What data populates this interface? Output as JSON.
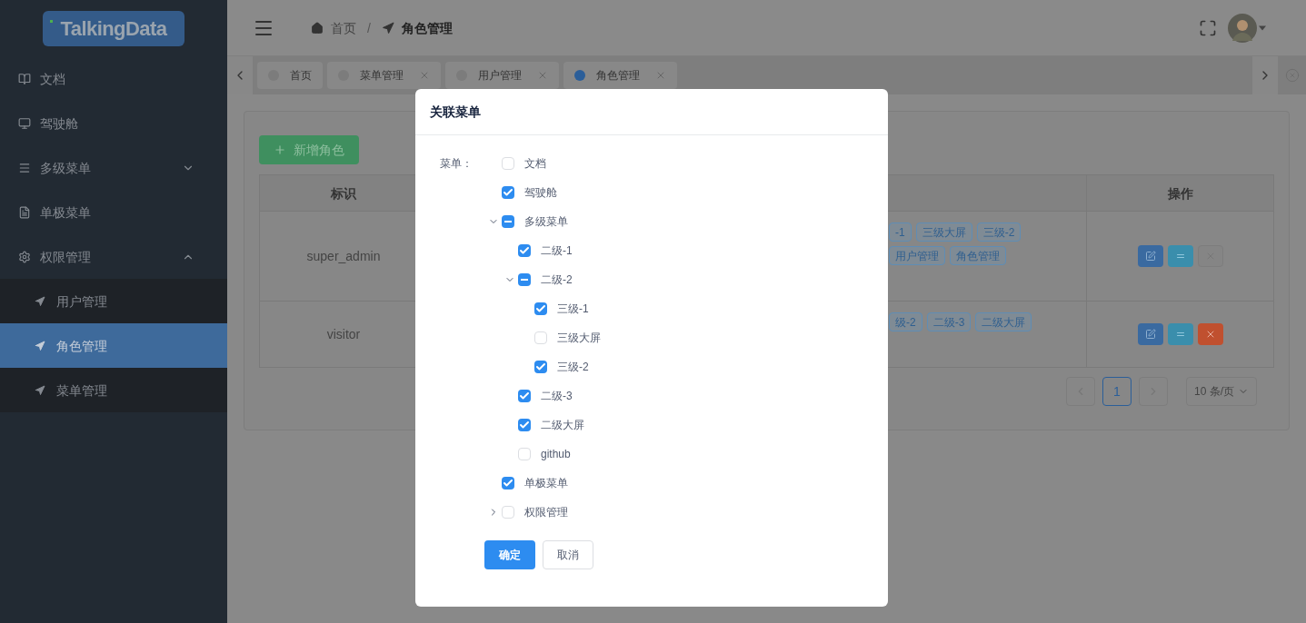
{
  "logo": {
    "text": "TalkingData"
  },
  "sidebar": {
    "items": [
      {
        "label": "文档",
        "kind": "book",
        "selected": false
      },
      {
        "label": "驾驶舱",
        "kind": "monitor",
        "selected": false
      },
      {
        "label": "多级菜单",
        "kind": "list",
        "selected": false,
        "expanded": false
      },
      {
        "label": "单极菜单",
        "kind": "file",
        "selected": false
      },
      {
        "label": "权限管理",
        "kind": "gear",
        "selected": false,
        "expanded": true,
        "children": [
          {
            "label": "用户管理",
            "selected": false
          },
          {
            "label": "角色管理",
            "selected": true
          },
          {
            "label": "菜单管理",
            "selected": false
          }
        ]
      }
    ]
  },
  "breadcrumb": {
    "separator": "/",
    "items": [
      {
        "label": "首页",
        "kind": "home"
      },
      {
        "label": "角色管理",
        "kind": "nav"
      }
    ]
  },
  "tabs": [
    {
      "label": "首页",
      "selected": false,
      "closable": false
    },
    {
      "label": "菜单管理",
      "selected": false,
      "closable": true
    },
    {
      "label": "用户管理",
      "selected": false,
      "closable": true
    },
    {
      "label": "角色管理",
      "selected": true,
      "closable": true
    }
  ],
  "add_button": {
    "label": "新增角色"
  },
  "table": {
    "columns": [
      "标识",
      "操作"
    ],
    "rows": [
      {
        "id": "super_admin",
        "tag_lines": [
          [
            "-1",
            "三级大屏",
            "三级-2"
          ],
          [
            "用户管理",
            "角色管理"
          ]
        ],
        "delete_disabled": true
      },
      {
        "id": "visitor",
        "tag_lines": [
          [
            "级-2",
            "二级-3",
            "二级大屏"
          ]
        ],
        "delete_disabled": false
      }
    ]
  },
  "pagination": {
    "pages": [
      {
        "label": "1",
        "selected": true
      }
    ],
    "page_size": "10 条/页"
  },
  "dialog": {
    "title": "关联菜单",
    "field_label": "菜单：",
    "tree": [
      {
        "label": "文档",
        "checked": false,
        "indeterminate": false
      },
      {
        "label": "驾驶舱",
        "checked": true,
        "indeterminate": false
      },
      {
        "label": "多级菜单",
        "checked": false,
        "indeterminate": true,
        "expanded": true,
        "children": [
          {
            "label": "二级-1",
            "checked": true,
            "indeterminate": false
          },
          {
            "label": "二级-2",
            "checked": false,
            "indeterminate": true,
            "expanded": true,
            "children": [
              {
                "label": "三级-1",
                "checked": true,
                "indeterminate": false
              },
              {
                "label": "三级大屏",
                "checked": false,
                "indeterminate": false
              },
              {
                "label": "三级-2",
                "checked": true,
                "indeterminate": false
              }
            ]
          },
          {
            "label": "二级-3",
            "checked": true,
            "indeterminate": false
          },
          {
            "label": "二级大屏",
            "checked": true,
            "indeterminate": false
          },
          {
            "label": "github",
            "checked": false,
            "indeterminate": false
          }
        ]
      },
      {
        "label": "单极菜单",
        "checked": true,
        "indeterminate": false
      },
      {
        "label": "权限管理",
        "checked": false,
        "indeterminate": false,
        "expanded": false
      }
    ],
    "buttons": [
      {
        "label": "确定",
        "kind": "primary"
      },
      {
        "label": "取消",
        "kind": "default"
      }
    ]
  }
}
